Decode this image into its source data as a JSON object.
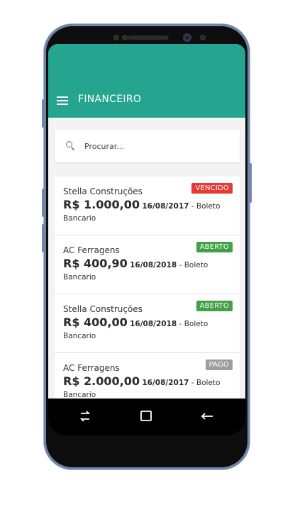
{
  "appbar": {
    "title": "FINANCEIRO"
  },
  "search": {
    "placeholder": "Procurar..."
  },
  "items": [
    {
      "client": "Stella Construções",
      "status": "VENCIDO",
      "status_color": "#e53935",
      "amount": "R$ 1.000,00",
      "date": "16/08/2017",
      "method_a": "- Boleto",
      "method_b": "Bancario"
    },
    {
      "client": "AC Ferragens",
      "status": "ABERTO",
      "status_color": "#43a047",
      "amount": "R$ 400,90",
      "date": "16/08/2018",
      "method_a": "- Boleto",
      "method_b": "Bancario"
    },
    {
      "client": "Stella Construções",
      "status": "ABERTO",
      "status_color": "#43a047",
      "amount": "R$ 400,00",
      "date": "16/08/2018",
      "method_a": "- Boleto",
      "method_b": "Bancario"
    },
    {
      "client": "AC Ferragens",
      "status": "PAGO",
      "status_color": "#9e9e9e",
      "amount": "R$ 2.000,00",
      "date": "16/08/2017",
      "method_a": "- Boleto",
      "method_b": "Bancario"
    }
  ],
  "colors": {
    "primary": "#25a58f",
    "background": "#f3f3f3"
  },
  "navbar": {
    "icons": [
      "recent-apps-icon",
      "home-icon",
      "back-icon"
    ]
  }
}
